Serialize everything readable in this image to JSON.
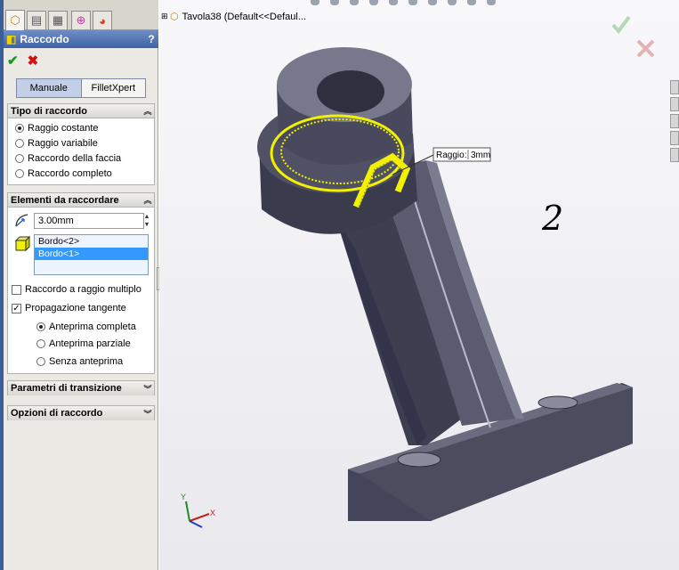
{
  "panel": {
    "title": "Raccordo",
    "help": "?",
    "mode_buttons": [
      "Manuale",
      "FilletXpert"
    ],
    "sections": {
      "tipo": {
        "title": "Tipo di raccordo",
        "options": [
          "Raggio costante",
          "Raggio variabile",
          "Raccordo della faccia",
          "Raccordo completo"
        ],
        "selected_index": 0
      },
      "elementi": {
        "title": "Elementi da raccordare",
        "radius_value": "3.00mm",
        "edges": [
          "Bordo<2>",
          "Bordo<1>"
        ],
        "selected_edge_index": 1,
        "multi_radius_label": "Raccordo a raggio multiplo",
        "multi_radius_checked": false,
        "tangent_label": "Propagazione tangente",
        "tangent_checked": true,
        "preview_options": [
          "Anteprima completa",
          "Anteprima parziale",
          "Senza anteprima"
        ],
        "preview_selected_index": 0
      },
      "transizione": {
        "title": "Parametri di transizione"
      },
      "opzioni": {
        "title": "Opzioni di raccordo"
      }
    }
  },
  "viewport": {
    "tree_label": "Tavola38  (Default<<Defaul...",
    "callout_label": "Raggio:",
    "callout_value": "3mm",
    "annotation": "2",
    "triad_labels": [
      "Y",
      "X"
    ]
  },
  "colors": {
    "title_bar": "#3e62a4",
    "selection": "#3399ff",
    "highlight": "#f2f200",
    "part": "#55566a"
  }
}
